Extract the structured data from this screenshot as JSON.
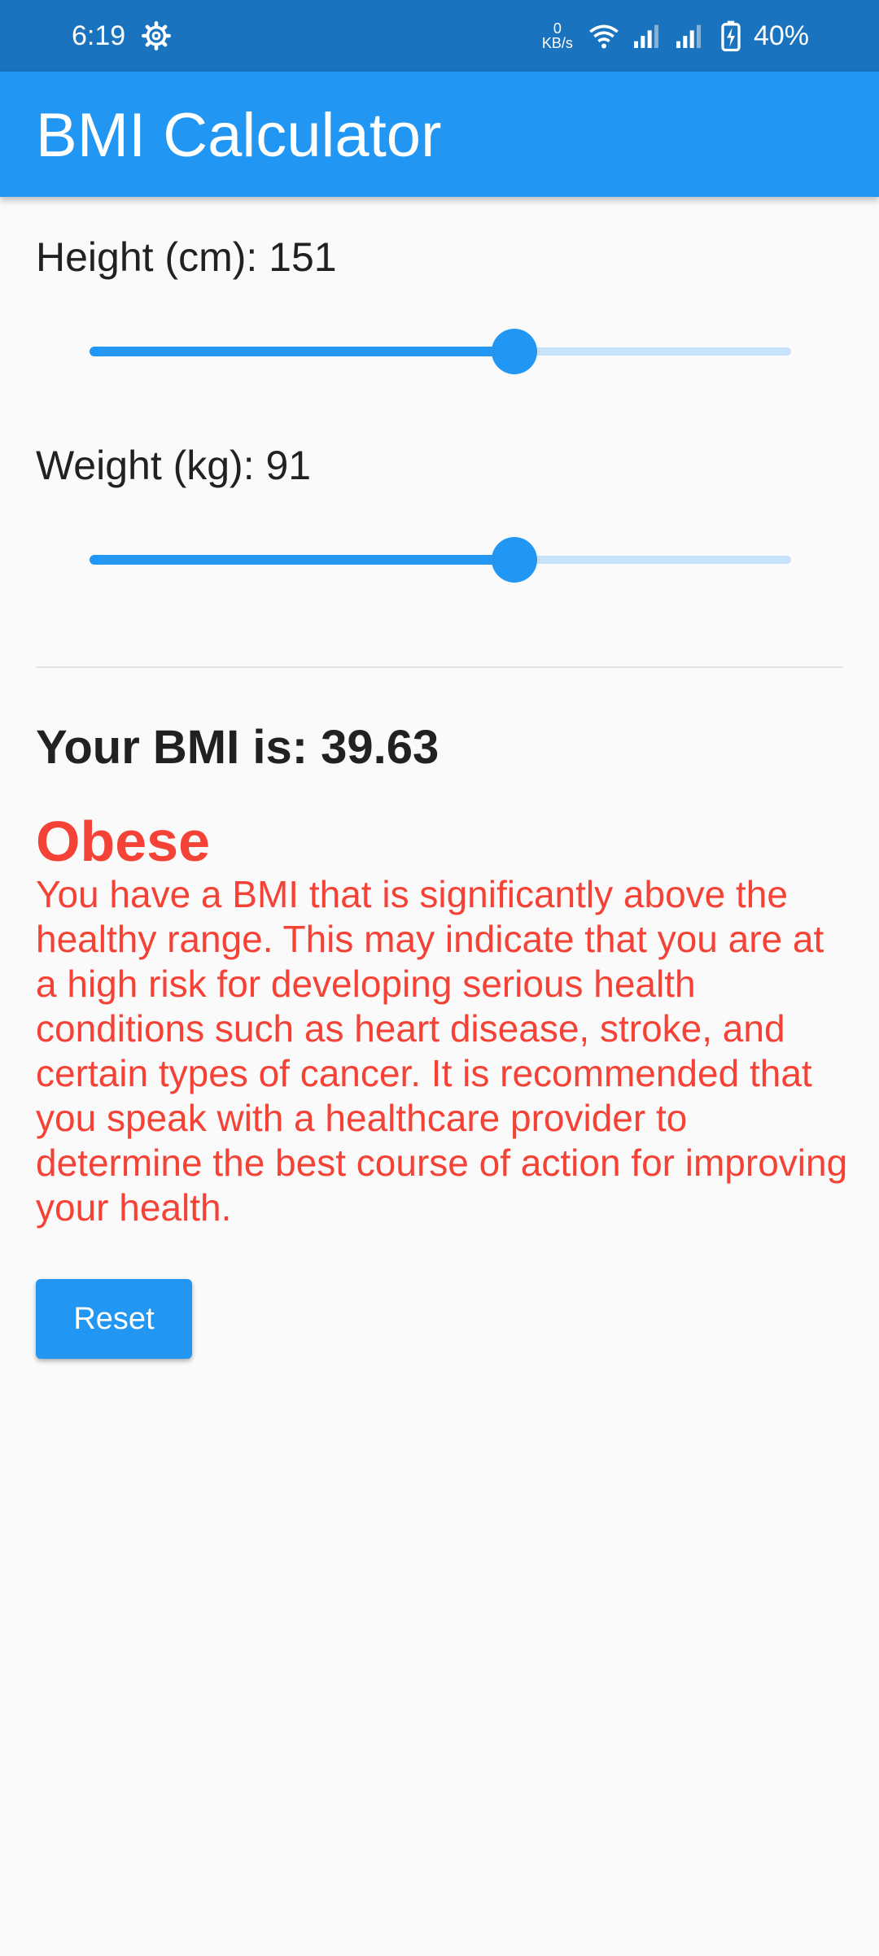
{
  "status_bar": {
    "time": "6:19",
    "net_speed_value": "0",
    "net_speed_unit": "KB/s",
    "battery": "40%",
    "icons": [
      "gear-icon",
      "wifi-icon",
      "signal-icon",
      "signal-icon",
      "battery-charging-icon"
    ]
  },
  "app_bar": {
    "title": "BMI Calculator"
  },
  "height": {
    "label": "Height (cm): 151",
    "value": 151,
    "slider_fraction": 0.605
  },
  "weight": {
    "label": "Weight (kg): 91",
    "value": 91,
    "slider_fraction": 0.605
  },
  "result": {
    "bmi_text": "Your BMI is: 39.63",
    "category": "Obese",
    "description": "You have a BMI that is significantly above the healthy range. This may indicate that you are at a high risk for developing serious health conditions such as heart disease, stroke, and certain types of cancer. It is recommended that you speak with a healthcare provider to determine the best course of action for improving your health."
  },
  "reset_label": "Reset",
  "colors": {
    "status_bar": "#1a73bf",
    "primary": "#2196f3",
    "track_inactive": "#c6e2fa",
    "warning": "#f44336",
    "background": "#fafafa"
  }
}
